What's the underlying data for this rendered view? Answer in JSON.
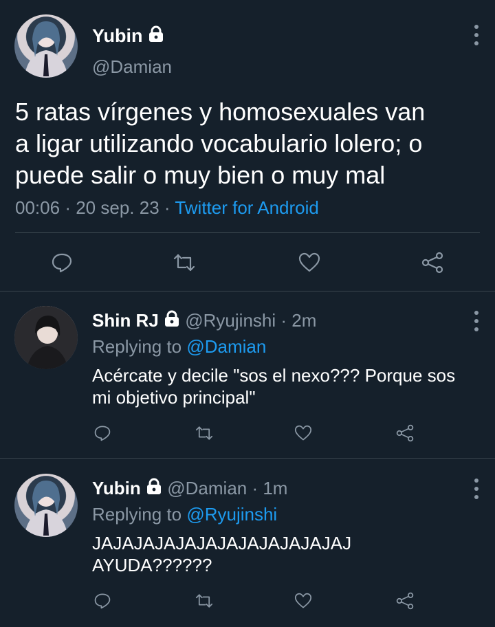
{
  "main_tweet": {
    "author_name": "Yubin",
    "author_handle": "@Damian",
    "text_line1": "5 ratas vírgenes y homosexuales van",
    "text_line2": "a ligar utilizando vocabulario lolero; o",
    "text_line3": "puede salir o muy bien o muy mal",
    "time": "00:06",
    "sep1": "·",
    "date": "20 sep. 23",
    "sep2": "·",
    "source": "Twitter for Android"
  },
  "replies": [
    {
      "author_name": "Shin RJ",
      "author_handle": "@Ryujinshi",
      "age": "· 2m",
      "replying_prefix": "Replying to",
      "replying_to": "@Damian",
      "text_line1": "Acércate y decile \"sos el nexo??? Porque sos",
      "text_line2": "mi objetivo principal\""
    },
    {
      "author_name": "Yubin",
      "author_handle": "@Damian",
      "age": "· 1m",
      "replying_prefix": "Replying to",
      "replying_to": "@Ryujinshi",
      "text_line1": "JAJAJAJAJAJAJAJAJAJAJAJAJ",
      "text_line2": "AYUDA??????"
    }
  ],
  "icons": {
    "more": "more-vertical-icon",
    "lock": "lock-icon",
    "reply": "reply-icon",
    "retweet": "retweet-icon",
    "like": "like-icon",
    "share": "share-icon"
  },
  "colors": {
    "background": "#15202b",
    "text": "#ffffff",
    "muted": "#8b98a5",
    "link": "#1d9bf0",
    "divider": "#38444d"
  }
}
